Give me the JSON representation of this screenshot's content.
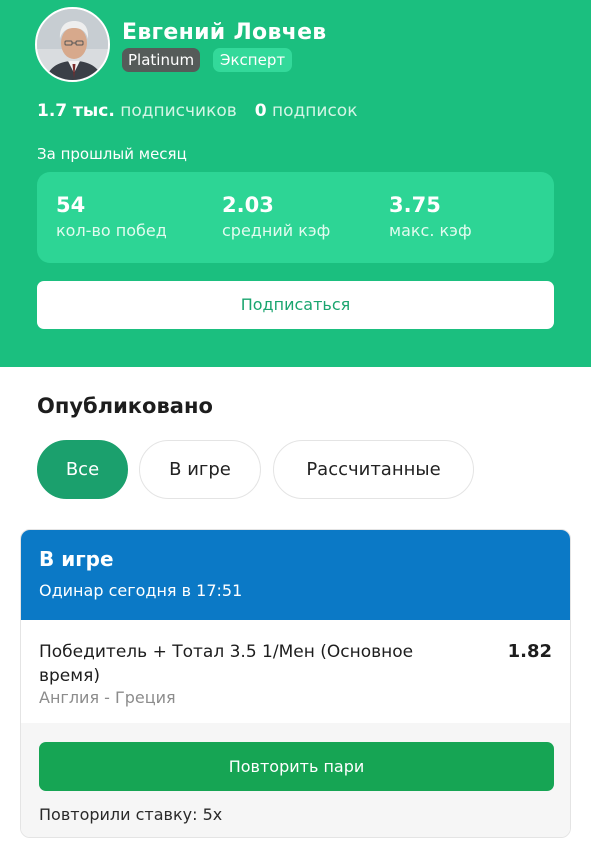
{
  "profile": {
    "name": "Евгений Ловчев",
    "badge_level": "Platinum",
    "badge_role": "Эксперт",
    "subscribers_value": "1.7 тыс.",
    "subscribers_label": "подписчиков",
    "subscriptions_value": "0",
    "subscriptions_label": "подписок"
  },
  "stats": {
    "period": "За прошлый месяц",
    "items": [
      {
        "value": "54",
        "label": "кол-во побед"
      },
      {
        "value": "2.03",
        "label": "средний кэф"
      },
      {
        "value": "3.75",
        "label": "макс. кэф"
      }
    ]
  },
  "subscribe_label": "Подписаться",
  "published": {
    "title": "Опубликовано",
    "filters": [
      "Все",
      "В игре",
      "Рассчитанные"
    ],
    "active_filter": "Все"
  },
  "bet_card": {
    "status": "В игре",
    "subtitle": "Одинар сегодня в 17:51",
    "selection": "Победитель + Тотал 3.5 1/Мен (Основное время)",
    "odds": "1.82",
    "match": "Англия - Греция",
    "repeat_label": "Повторить пари",
    "repeated_text": "Повторили ставку: 5x"
  },
  "colors": {
    "header_bg": "#1bbf7f",
    "stat_box_bg": "#2dd595",
    "card_head_bg": "#0b79c6",
    "repeat_button_bg": "#16a554"
  }
}
